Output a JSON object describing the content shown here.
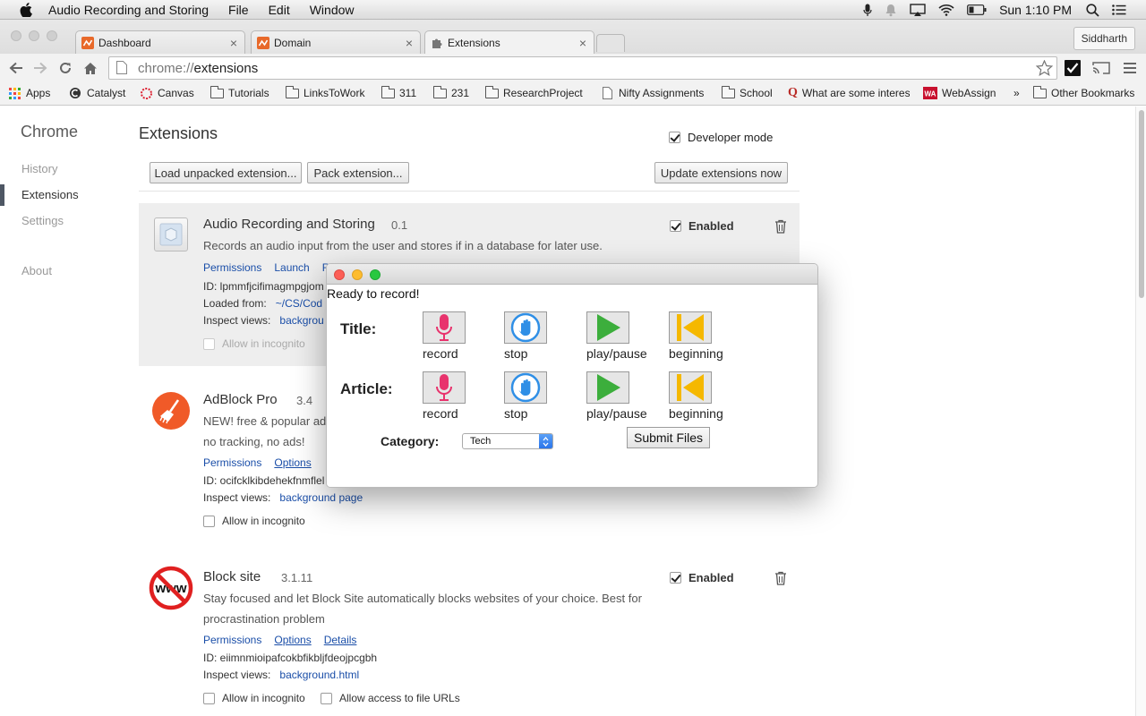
{
  "menubar": {
    "app_name": "Audio Recording and Storing",
    "menus": [
      "File",
      "Edit",
      "Window"
    ],
    "clock": "Sun 1:10 PM",
    "icons": [
      "apple-icon",
      "microphone-icon",
      "notification-bell-icon",
      "airplay-icon",
      "wifi-icon",
      "battery-icon",
      "spotlight-search-icon",
      "notification-center-icon"
    ]
  },
  "tabs": [
    {
      "title": "Dashboard",
      "icon": "canvas-logo-icon"
    },
    {
      "title": "Domain",
      "icon": "canvas-logo-icon"
    },
    {
      "title": "Extensions",
      "icon": "puzzle-icon"
    }
  ],
  "profile_name": "Siddharth",
  "omnibox": {
    "scheme": "chrome://",
    "path": "extensions"
  },
  "bookmarks": [
    "Apps",
    "Catalyst",
    "Canvas",
    "Tutorials",
    "LinksToWork",
    "311",
    "231",
    "ResearchProject",
    "Nifty Assignments",
    "School",
    "What are some interes",
    "WebAssign",
    "»",
    "Other Bookmarks"
  ],
  "sidebar": {
    "brand": "Chrome",
    "items": [
      "History",
      "Extensions",
      "Settings"
    ],
    "about": "About"
  },
  "page": {
    "title": "Extensions",
    "developer_mode": "Developer mode",
    "load_unpacked": "Load unpacked extension...",
    "pack": "Pack extension...",
    "update": "Update extensions now"
  },
  "extensions": [
    {
      "name": "Audio Recording and Storing",
      "version": "0.1",
      "description": "Records an audio input from the user and stores if in a database for later use.",
      "links": [
        "Permissions",
        "Launch",
        "R"
      ],
      "id_label": "ID: ",
      "id": "lpmmfjcifimagmpgjom",
      "loaded_label": "Loaded from:",
      "loaded_path": "~/CS/Cod",
      "inspect_label": "Inspect views:",
      "inspect_value": "backgrou",
      "incognito": "Allow in incognito",
      "enabled": "Enabled"
    },
    {
      "name": "AdBlock Pro",
      "version": "3.4",
      "description_line1": "NEW! free & popular ad",
      "description_line2": "no tracking, no ads!",
      "links": [
        "Permissions",
        "Options"
      ],
      "id_label": "ID: ",
      "id": "ocifcklkibdehekfnmflel",
      "inspect_label": "Inspect views:",
      "inspect_value": "background page",
      "incognito": "Allow in incognito"
    },
    {
      "name": "Block site",
      "version": "3.1.11",
      "description_line1": "Stay focused and let Block Site automatically blocks websites of your choice. Best for",
      "description_line2": "procrastination problem",
      "links": [
        "Permissions",
        "Options",
        "Details"
      ],
      "id_label": "ID: ",
      "id": "eiimnmioipafcokbfikbljfdeojpcgbh",
      "inspect_label": "Inspect views:",
      "inspect_value": "background.html",
      "incognito": "Allow in incognito",
      "file_urls": "Allow access to file URLs",
      "enabled": "Enabled"
    }
  ],
  "popup": {
    "status": "Ready to record!",
    "rows": [
      {
        "label": "Title:"
      },
      {
        "label": "Article:"
      }
    ],
    "button_captions": [
      "record",
      "stop",
      "play/pause",
      "beginning"
    ],
    "category_label": "Category:",
    "category_value": "Tech",
    "submit": "Submit Files",
    "colors": {
      "record": "#e8336d",
      "stop": "#2f8fe6",
      "play": "#3cae3c",
      "beginning": "#f5b800"
    }
  }
}
